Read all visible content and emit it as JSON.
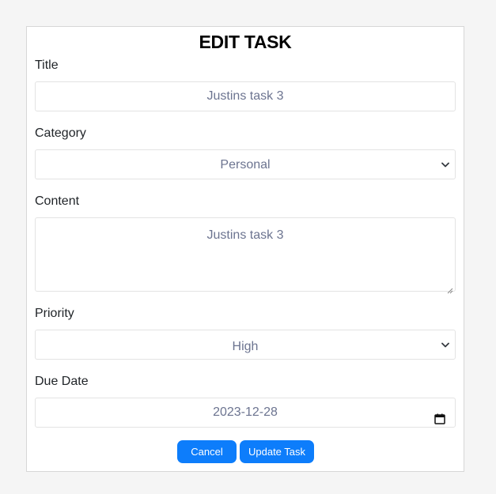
{
  "form": {
    "heading": "EDIT TASK",
    "title_label": "Title",
    "title_value": "Justins task 3",
    "category_label": "Category",
    "category_value": "Personal",
    "content_label": "Content",
    "content_value": "Justins task 3",
    "priority_label": "Priority",
    "priority_value": "High",
    "due_label": "Due Date",
    "due_value": "2023-12-28",
    "cancel_label": "Cancel",
    "update_label": "Update Task"
  },
  "colors": {
    "accent": "#0d7dfb",
    "field_text": "#6c7490",
    "background": "#f5f5f5"
  },
  "icons": {
    "select_arrow": "chevron-down-icon",
    "date_picker": "calendar-icon",
    "textarea_resize": "resize-handle-icon"
  }
}
